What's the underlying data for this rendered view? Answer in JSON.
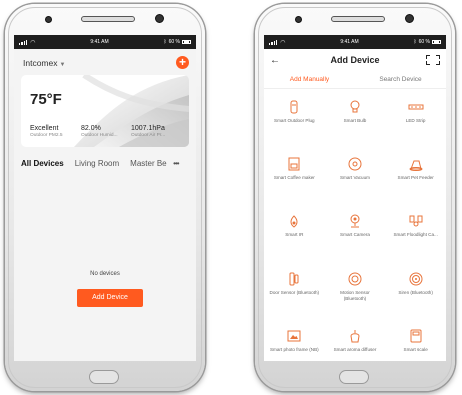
{
  "left": {
    "status": {
      "time": "9:41 AM",
      "battery": "60 %"
    },
    "home_name": "Intcomex",
    "weather": {
      "temperature": "75°F",
      "metrics": [
        {
          "value": "Excellent",
          "label": "Outdoor PM2.5"
        },
        {
          "value": "82.0%",
          "label": "Outdoor Humid..."
        },
        {
          "value": "1007.1hPa",
          "label": "Outdoor Air Pr..."
        }
      ]
    },
    "rooms": [
      "All Devices",
      "Living Room",
      "Master Be"
    ],
    "more": "•••",
    "empty_text": "No devices",
    "add_device_label": "Add Device"
  },
  "right": {
    "status": {
      "time": "9:41 AM",
      "battery": "60 %"
    },
    "title": "Add Device",
    "tabs": [
      "Add Manually",
      "Search Device"
    ],
    "devices": [
      {
        "label": "Smart Outdoor Plug",
        "icon": "outdoor-plug-icon"
      },
      {
        "label": "Smart Bulb",
        "icon": "bulb-icon"
      },
      {
        "label": "LED Strip",
        "icon": "led-strip-icon"
      },
      {
        "label": "Smart Coffee maker",
        "icon": "coffee-maker-icon"
      },
      {
        "label": "Smart Vacuum",
        "icon": "vacuum-icon"
      },
      {
        "label": "Smart Pet Feeder",
        "icon": "pet-feeder-icon"
      },
      {
        "label": "Smart IR",
        "icon": "ir-icon"
      },
      {
        "label": "Smart Camera",
        "icon": "camera-icon"
      },
      {
        "label": "Smart Floodlight Ca...",
        "icon": "floodlight-icon"
      },
      {
        "label": "Door Sensor (Bluetooth)",
        "icon": "door-sensor-icon"
      },
      {
        "label": "Motion Sensor (Bluetooth)",
        "icon": "motion-sensor-icon"
      },
      {
        "label": "Siren (Bluetooth)",
        "icon": "siren-icon"
      },
      {
        "label": "Smart photo frame (NB)",
        "icon": "photo-frame-icon"
      },
      {
        "label": "Smart aroma diffuser",
        "icon": "aroma-diffuser-icon"
      },
      {
        "label": "Smart scale",
        "icon": "scale-icon"
      }
    ]
  },
  "colors": {
    "accent": "#ff5a1f",
    "icon_stroke": "#e8743b"
  }
}
